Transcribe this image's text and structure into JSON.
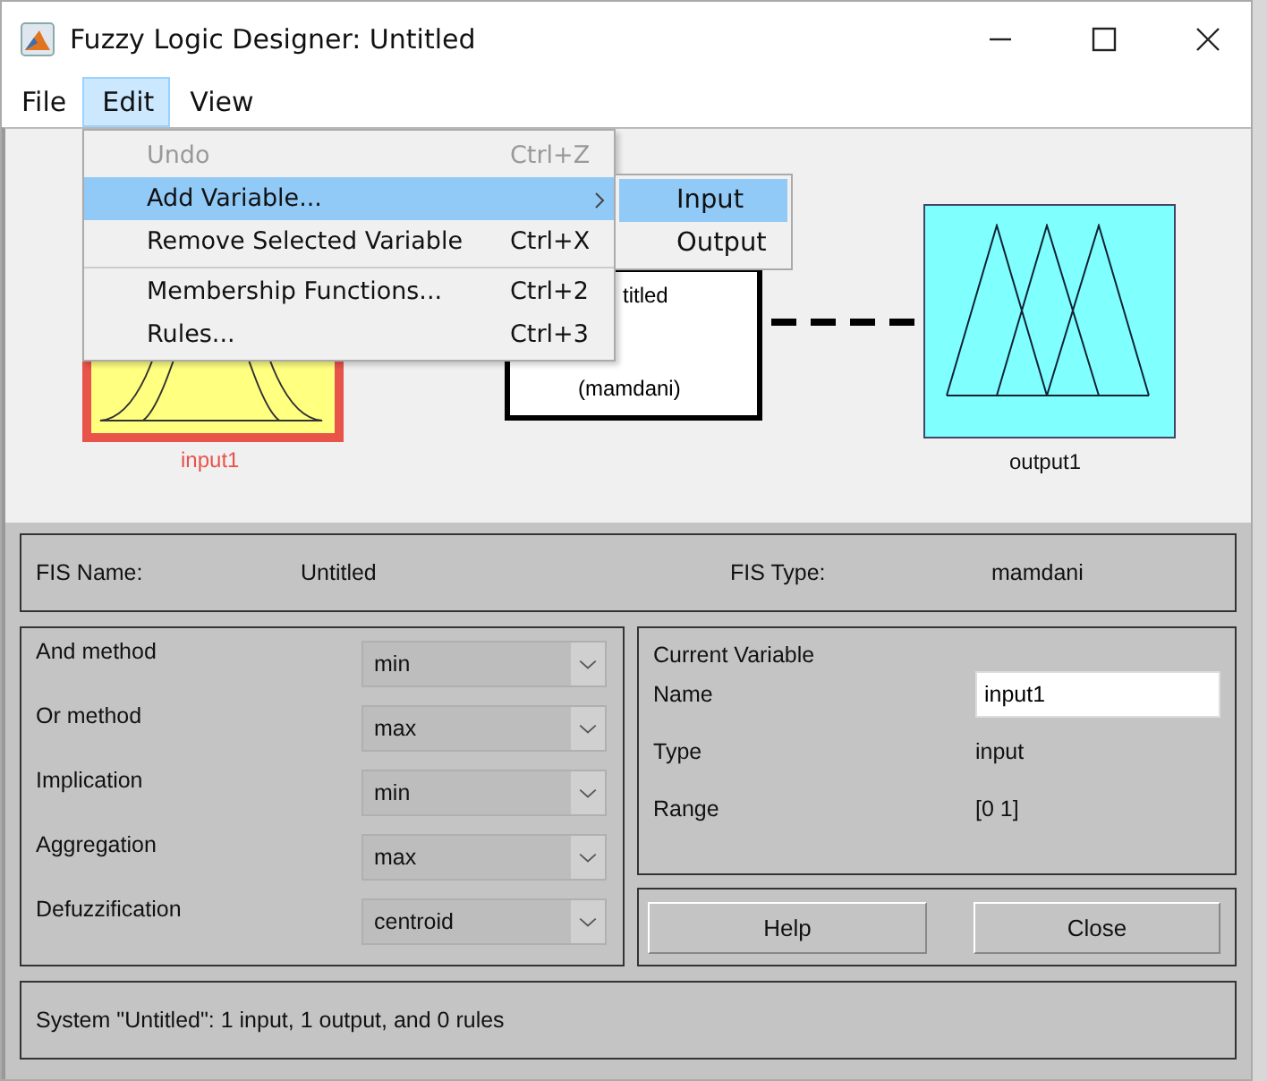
{
  "window": {
    "title": "Fuzzy Logic Designer: Untitled"
  },
  "menu_bar": [
    {
      "label": "File",
      "selected": false
    },
    {
      "label": "Edit",
      "selected": true
    },
    {
      "label": "View",
      "selected": false
    }
  ],
  "edit_menu": [
    {
      "label": "Undo",
      "shortcut": "Ctrl+Z",
      "disabled": true,
      "selected": false,
      "separator_before": false,
      "submenu": false
    },
    {
      "label": "Add Variable...",
      "disabled": false,
      "selected": true,
      "separator_before": false,
      "submenu": true
    },
    {
      "label": "Remove Selected Variable",
      "shortcut": "Ctrl+X",
      "disabled": false,
      "selected": false,
      "separator_before": false,
      "submenu": false
    },
    {
      "label": "Membership Functions...",
      "shortcut": "Ctrl+2",
      "disabled": false,
      "selected": false,
      "separator_before": true,
      "submenu": false
    },
    {
      "label": "Rules...",
      "shortcut": "Ctrl+3",
      "disabled": false,
      "selected": false,
      "separator_before": false,
      "submenu": false
    }
  ],
  "submenu": [
    {
      "label": "Input",
      "selected": true
    },
    {
      "label": "Output",
      "selected": false
    }
  ],
  "diagram": {
    "input": {
      "label": "input1",
      "selected": true
    },
    "system": {
      "lines": [
        "titled",
        "(mamdani)"
      ]
    },
    "output": {
      "label": "output1",
      "selected": false
    }
  },
  "fis": {
    "name_label": "FIS Name:",
    "name": "Untitled",
    "type_label": "FIS Type:",
    "type": "mamdani"
  },
  "methods": [
    {
      "label": "And method",
      "value": "min"
    },
    {
      "label": "Or method",
      "value": "max"
    },
    {
      "label": "Implication",
      "value": "min"
    },
    {
      "label": "Aggregation",
      "value": "max"
    },
    {
      "label": "Defuzzification",
      "value": "centroid"
    }
  ],
  "current_variable": {
    "title": "Current Variable",
    "rows": [
      {
        "label": "Name",
        "value": "input1",
        "kind": "field"
      },
      {
        "label": "Type",
        "value": "input",
        "kind": "text"
      },
      {
        "label": "Range",
        "value": "[0 1]",
        "kind": "text"
      }
    ]
  },
  "buttons": [
    "Help",
    "Close"
  ],
  "status": "System \"Untitled\": 1 input, 1 output, and 0 rules"
}
